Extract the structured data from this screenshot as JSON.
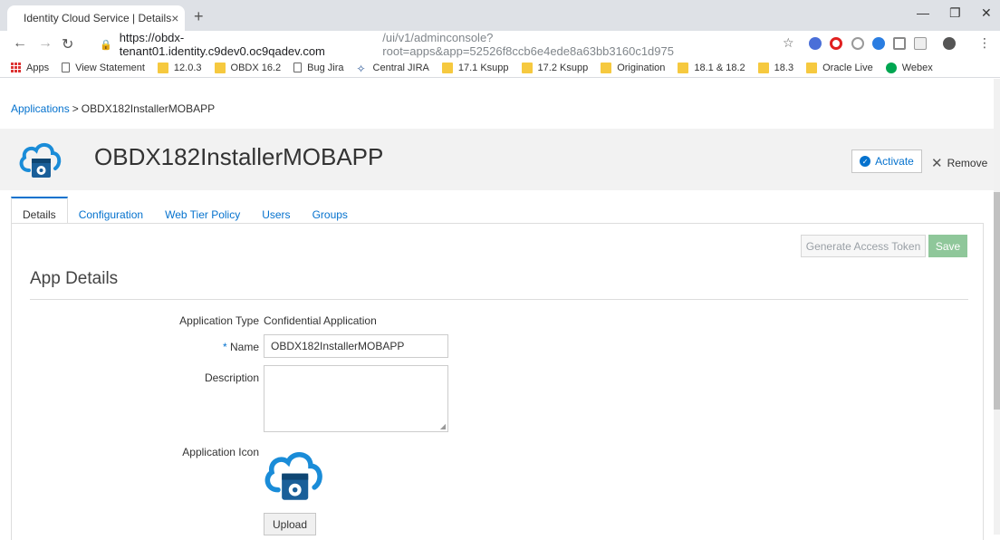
{
  "browser": {
    "tab_title": "Identity Cloud Service | Details",
    "tab_close": "×",
    "new_tab": "+",
    "url_host": "https://obdx-tenant01.identity.c9dev0.oc9qadev.com",
    "url_path": "/ui/v1/adminconsole?root=apps&app=52526f8ccb6e4ede8a63bb3160c1d975",
    "bookmarks": [
      {
        "label": "Apps",
        "icon": "apps-grid-icon"
      },
      {
        "label": "View Statement",
        "icon": "page-icon"
      },
      {
        "label": "12.0.3",
        "icon": "folder-icon"
      },
      {
        "label": "OBDX 16.2",
        "icon": "folder-icon"
      },
      {
        "label": "Bug Jira",
        "icon": "page-icon"
      },
      {
        "label": "Central JIRA",
        "icon": "jira-icon"
      },
      {
        "label": "17.1 Ksupp",
        "icon": "folder-icon"
      },
      {
        "label": "17.2 Ksupp",
        "icon": "folder-icon"
      },
      {
        "label": "Origination",
        "icon": "folder-icon"
      },
      {
        "label": "18.1 & 18.2",
        "icon": "folder-icon"
      },
      {
        "label": "18.3",
        "icon": "folder-icon"
      },
      {
        "label": "Oracle Live",
        "icon": "folder-icon"
      },
      {
        "label": "Webex",
        "icon": "webex-icon"
      }
    ]
  },
  "breadcrumb": {
    "parent": "Applications",
    "separator": ">",
    "current": "OBDX182InstallerMOBAPP"
  },
  "header": {
    "app_name": "OBDX182InstallerMOBAPP",
    "activate_label": "Activate",
    "remove_label": "Remove"
  },
  "tabs": [
    {
      "label": "Details",
      "active": true
    },
    {
      "label": "Configuration",
      "active": false
    },
    {
      "label": "Web Tier Policy",
      "active": false
    },
    {
      "label": "Users",
      "active": false
    },
    {
      "label": "Groups",
      "active": false
    }
  ],
  "actions": {
    "generate_token_label": "Generate Access Token",
    "save_label": "Save"
  },
  "form": {
    "section_title": "App Details",
    "app_type_label": "Application Type",
    "app_type_value": "Confidential Application",
    "name_required_mark": "*",
    "name_label": "Name",
    "name_value": "OBDX182InstallerMOBAPP",
    "description_label": "Description",
    "description_value": "",
    "icon_label": "Application Icon",
    "upload_label": "Upload"
  },
  "colors": {
    "link": "#0572ce",
    "save_disabled": "#8fc79a",
    "header_bg": "#f2f2f2"
  }
}
